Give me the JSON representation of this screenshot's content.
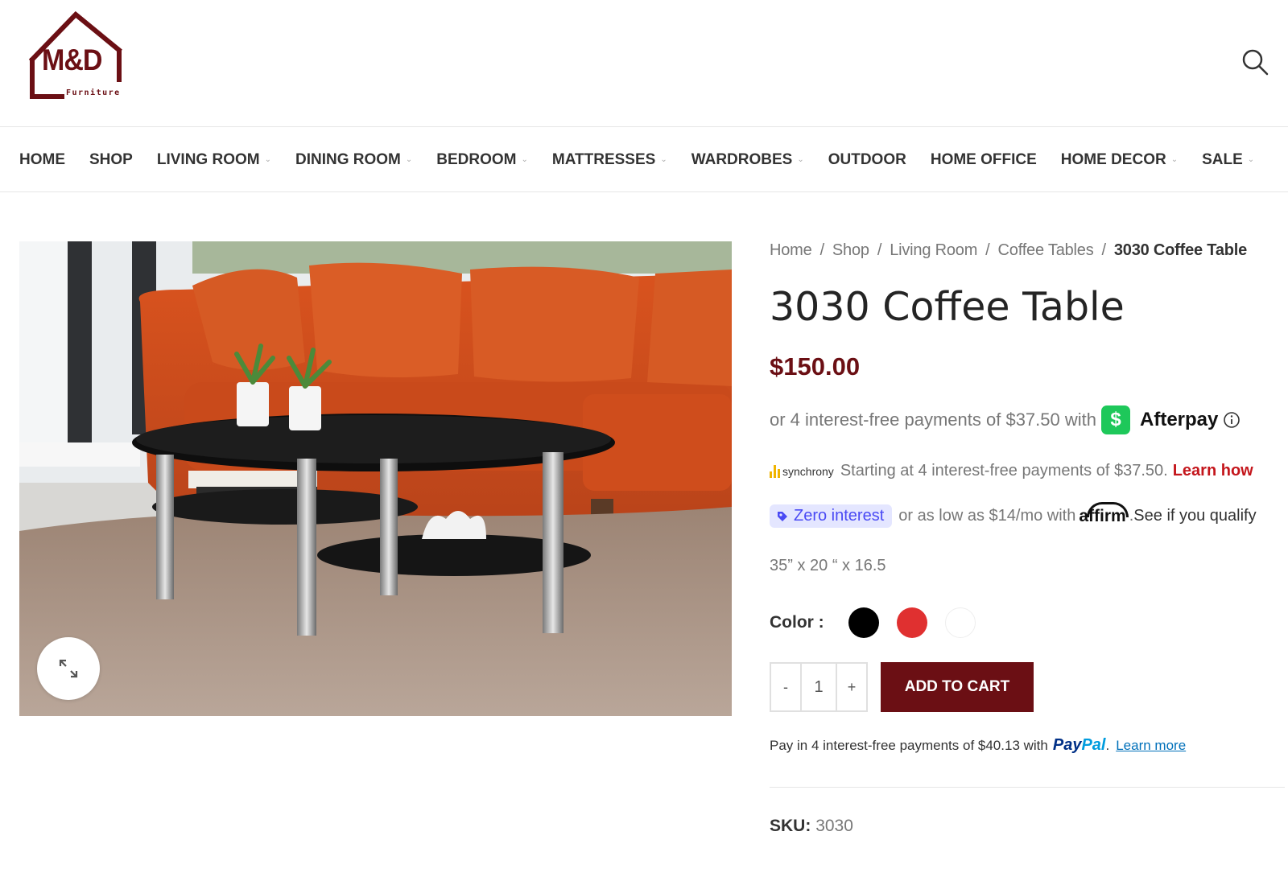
{
  "brand": {
    "name": "M&D",
    "tagline": "Furniture",
    "accent": "#6b0f14"
  },
  "nav": [
    {
      "label": "HOME",
      "has_dropdown": false
    },
    {
      "label": "SHOP",
      "has_dropdown": false
    },
    {
      "label": "LIVING ROOM",
      "has_dropdown": true
    },
    {
      "label": "DINING ROOM",
      "has_dropdown": true
    },
    {
      "label": "BEDROOM",
      "has_dropdown": true
    },
    {
      "label": "MATTRESSES",
      "has_dropdown": true
    },
    {
      "label": "WARDROBES",
      "has_dropdown": true
    },
    {
      "label": "OUTDOOR",
      "has_dropdown": false
    },
    {
      "label": "HOME OFFICE",
      "has_dropdown": false
    },
    {
      "label": "HOME DECOR",
      "has_dropdown": true
    },
    {
      "label": "SALE",
      "has_dropdown": true
    }
  ],
  "breadcrumb": {
    "home": "Home",
    "shop": "Shop",
    "living_room": "Living Room",
    "coffee_tables": "Coffee Tables",
    "current": "3030 Coffee Table",
    "sep": "/"
  },
  "product": {
    "title": "3030 Coffee Table",
    "price": "$150.00",
    "dimensions": "35” x 20 “ x 16.5",
    "color_label": "Color :",
    "colors": [
      "#000000",
      "#e03030",
      "#ffffff"
    ],
    "quantity": "1",
    "minus": "-",
    "plus": "+",
    "add_to_cart": "ADD TO CART",
    "sku_label": "SKU:",
    "sku": "3030"
  },
  "afterpay": {
    "text": "or 4 interest-free payments of $37.50 with",
    "badge": "$",
    "name": "Afterpay"
  },
  "synchrony": {
    "logo": "synchrony",
    "text": "Starting at 4 interest-free payments of $37.50.",
    "link": "Learn how"
  },
  "affirm": {
    "pill": "Zero interest",
    "text": "or as low as $14/mo with",
    "logo": "affirm",
    "link": "See if you qualify"
  },
  "paypal": {
    "text": "Pay in 4 interest-free payments of $40.13 with",
    "logo_a": "Pay",
    "logo_b": "Pal",
    "dot": ".",
    "link": "Learn more"
  }
}
